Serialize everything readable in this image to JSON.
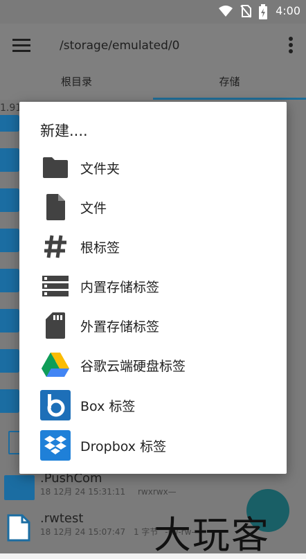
{
  "status_bar": {
    "time": "4:00"
  },
  "app_bar": {
    "path": "/storage/emulated/0"
  },
  "tabs": [
    {
      "label": "根目录"
    },
    {
      "label": "存储"
    }
  ],
  "background": {
    "partial_text": "1.91",
    "rows": [
      {
        "name": ".PushCom",
        "date": "18 12月 24 15:31:11",
        "perm": "rwxrwx—"
      },
      {
        "name": ".rwtest",
        "date": "18 12月 24 15:07:47",
        "size": "1 字节",
        "perm": "-rw-rw—"
      }
    ]
  },
  "dialog": {
    "title": "新建....",
    "options": [
      {
        "label": "文件夹",
        "icon": "folder-icon"
      },
      {
        "label": "文件",
        "icon": "file-icon"
      },
      {
        "label": "根标签",
        "icon": "hash-icon"
      },
      {
        "label": "内置存储标签",
        "icon": "storage-icon"
      },
      {
        "label": "外置存储标签",
        "icon": "sd-card-icon"
      },
      {
        "label": "谷歌云端硬盘标签",
        "icon": "google-drive-icon"
      },
      {
        "label": "Box 标签",
        "icon": "box-icon"
      },
      {
        "label": "Dropbox 标签",
        "icon": "dropbox-icon"
      }
    ]
  },
  "watermark": "大玩客",
  "colors": {
    "accent": "#1e6e99",
    "folder": "#1b6da2",
    "icon": "#424242"
  }
}
